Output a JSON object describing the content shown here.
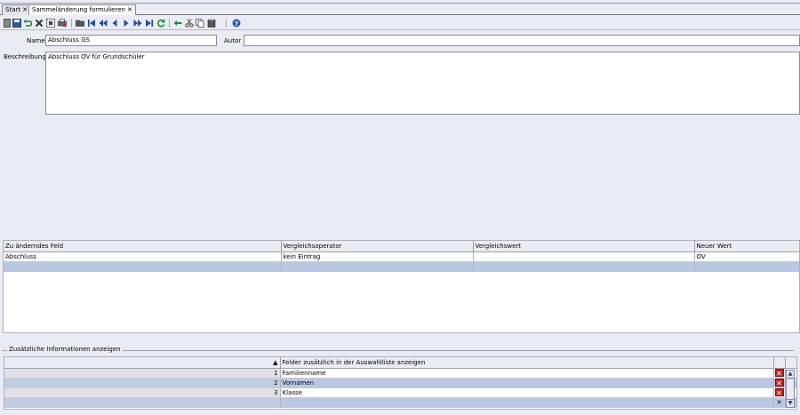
{
  "tabs": [
    {
      "label": "Start",
      "close": "✕"
    },
    {
      "label": "Sammeländerung formulieren",
      "close": "✕"
    }
  ],
  "toolbar": {
    "icons": [
      "new-doc-icon",
      "save-icon",
      "undo-icon",
      "delete-icon",
      "select-icon",
      "print-icon",
      "folder-icon",
      "first-record-icon",
      "prev-page-icon",
      "prev-record-icon",
      "next-record-icon",
      "next-page-icon",
      "last-record-icon",
      "refresh-icon",
      "back-arrow-icon",
      "cut-icon",
      "copy-icon",
      "paste-icon",
      "help-icon"
    ]
  },
  "form": {
    "name_label": "Name",
    "name_value": "Abschluss GS",
    "autor_label": "Autor",
    "autor_value": "",
    "beschreibung_label": "Beschreibung",
    "beschreibung_value": "Abschluss OV für Grundschüler"
  },
  "changes_table": {
    "columns": [
      "Zu änderndes Feld",
      "Vergleichsoperator",
      "Vergleichswert",
      "Neuer Wert"
    ],
    "rows": [
      [
        "Abschluss",
        "kein Eintrag",
        "",
        "OV"
      ],
      [
        "",
        "",
        "",
        ""
      ]
    ]
  },
  "extra_info": {
    "group_title": "Zusätzliche Informationen anzeigen",
    "sort_indicator": "▲",
    "column": "Felder zusätzlich in der Auswahlliste anzeigen",
    "rows": [
      {
        "num": "1",
        "field": "Familienname"
      },
      {
        "num": "2",
        "field": "Vornamen"
      },
      {
        "num": "3",
        "field": "Klasse"
      },
      {
        "num": "",
        "field": ""
      }
    ],
    "delete_glyph": "✕",
    "scroll_up": "▲",
    "scroll_down": "▼"
  }
}
